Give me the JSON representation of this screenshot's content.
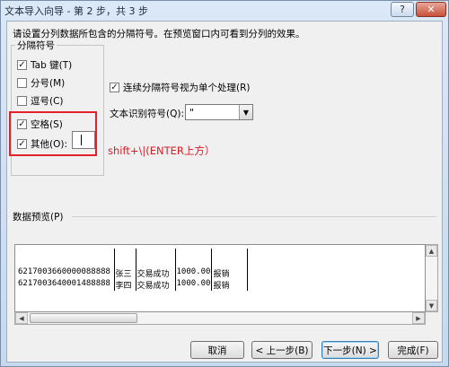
{
  "window": {
    "title": "文本导入向导 - 第 2 步，共 3 步",
    "help_glyph": "?",
    "close_glyph": "✕"
  },
  "instruction": "请设置分列数据所包含的分隔符号。在预览窗口内可看到分列的效果。",
  "delimiters": {
    "group_label": "分隔符号",
    "items": [
      {
        "label": "Tab 键(T)",
        "checked": true
      },
      {
        "label": "分号(M)",
        "checked": false
      },
      {
        "label": "逗号(C)",
        "checked": false
      },
      {
        "label": "空格(S)",
        "checked": true
      },
      {
        "label": "其他(O):",
        "checked": true
      }
    ],
    "other_value": ""
  },
  "consecutive": {
    "label": "连续分隔符号视为单个处理(R)",
    "checked": true
  },
  "text_qualifier": {
    "label": "文本识别符号(Q):",
    "value": "\""
  },
  "annotation": "shift+\\|(ENTER上方）",
  "preview": {
    "label": "数据预览(P)",
    "rows": [
      [
        "",
        "",
        "",
        "",
        "",
        ""
      ],
      [
        "6217003660000088888",
        "张三",
        "交易成功",
        "1000.00",
        "报销",
        ""
      ],
      [
        "6217003640001488888",
        "李四",
        "交易成功",
        "1000.00",
        "报销",
        ""
      ]
    ]
  },
  "buttons": {
    "cancel": "取消",
    "back": "< 上一步(B)",
    "next": "下一步(N) >",
    "finish": "完成(F)"
  },
  "check_glyph": "✓"
}
